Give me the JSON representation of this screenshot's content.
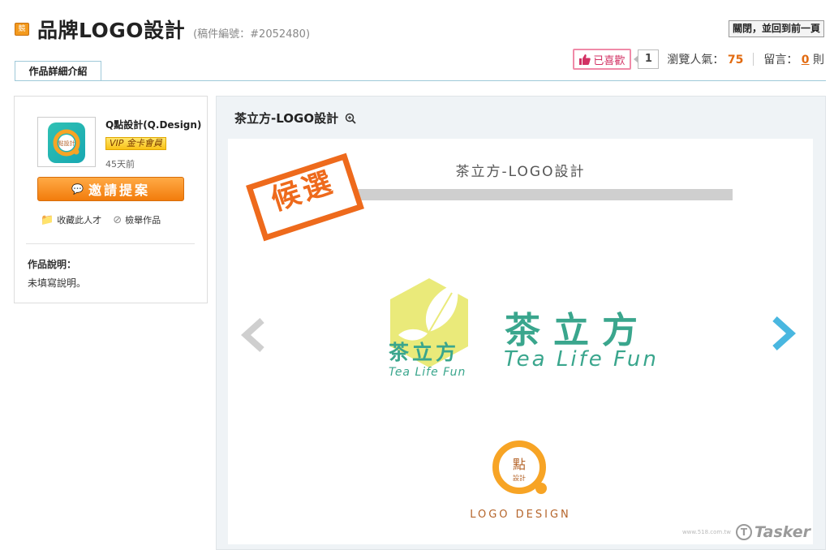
{
  "header": {
    "icon_label": "競",
    "title": "品牌LOGO設計",
    "case_no": "(稿件編號：#2052480)",
    "close_button": "關閉，並回到前一頁"
  },
  "tabs": [
    {
      "label": "作品詳細介紹"
    }
  ],
  "stats": {
    "like_label": "已喜歡",
    "like_count": "1",
    "views_label": "瀏覽人氣：",
    "views_value": "75",
    "comments_label": "留言：",
    "comments_value": "0",
    "comments_unit": "則"
  },
  "designer": {
    "name": "Q點設計(Q.Design)",
    "badge": "VIP 金卡會員",
    "last_active": "45天前",
    "avatar_text": "點設計",
    "invite_button": "邀請提案",
    "favorite_label": "收藏此人才",
    "report_label": "檢舉作品",
    "description_label": "作品說明：",
    "description": "未填寫說明。"
  },
  "work": {
    "title": "茶立方-LOGO設計",
    "heading": "茶立方-LOGO設計",
    "stamp": "候選",
    "logo_cn": "茶立方",
    "logo_script": "Tea Life Fun",
    "studio_mark": "點",
    "studio_mark_sub": "設計",
    "studio_tagline": "LOGO DESIGN"
  },
  "watermark": {
    "brand": "Tasker",
    "url": "www.518.com.tw"
  },
  "colors": {
    "accent_orange": "#f27c0c",
    "brand_teal": "#3aa68d",
    "stamp_orange": "#ee6a1c",
    "link_blue": "#49b7e0"
  }
}
